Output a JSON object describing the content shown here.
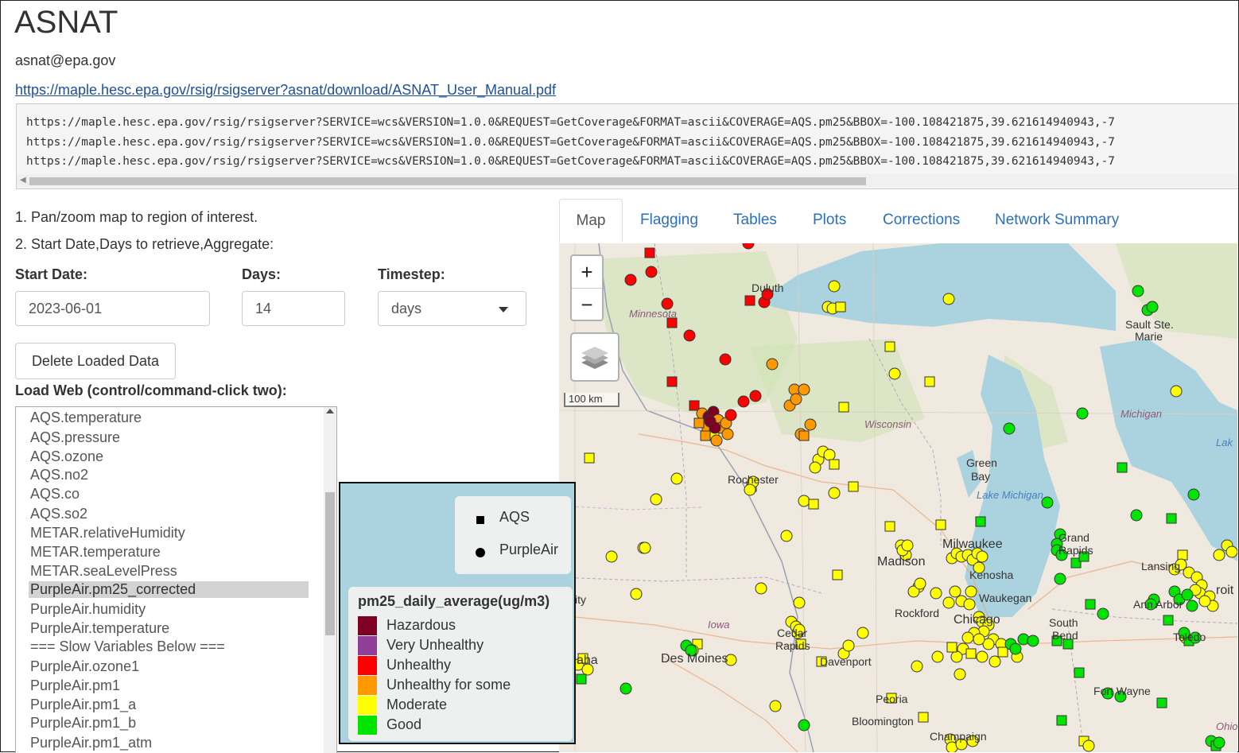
{
  "header": {
    "title": "ASNAT",
    "email": "asnat@epa.gov",
    "manual_link": "https://maple.hesc.epa.gov/rsig/rsigserver?asnat/download/ASNAT_User_Manual.pdf"
  },
  "request_urls": [
    "https://maple.hesc.epa.gov/rsig/rsigserver?SERVICE=wcs&VERSION=1.0.0&REQUEST=GetCoverage&FORMAT=ascii&COVERAGE=AQS.pm25&BBOX=-100.108421875,39.621614940943,-7",
    "https://maple.hesc.epa.gov/rsig/rsigserver?SERVICE=wcs&VERSION=1.0.0&REQUEST=GetCoverage&FORMAT=ascii&COVERAGE=AQS.pm25&BBOX=-100.108421875,39.621614940943,-7",
    "https://maple.hesc.epa.gov/rsig/rsigserver?SERVICE=wcs&VERSION=1.0.0&REQUEST=GetCoverage&FORMAT=ascii&COVERAGE=AQS.pm25&BBOX=-100.108421875,39.621614940943,-7"
  ],
  "steps": {
    "step1": "1. Pan/zoom map to region of interest.",
    "step2": "2. Start Date,Days to retrieve,Aggregate:"
  },
  "form": {
    "start_date_label": "Start Date:",
    "start_date_value": "2023-06-01",
    "days_label": "Days:",
    "days_value": "14",
    "timestep_label": "Timestep:",
    "timestep_value": "days",
    "delete_button": "Delete Loaded Data",
    "load_web_label": "Load Web (control/command-click two):"
  },
  "variables": [
    "AQS.temperature",
    "AQS.pressure",
    "AQS.ozone",
    "AQS.no2",
    "AQS.co",
    "AQS.so2",
    "METAR.relativeHumidity",
    "METAR.temperature",
    "METAR.seaLevelPress",
    "PurpleAir.pm25_corrected",
    "PurpleAir.humidity",
    "PurpleAir.temperature",
    "=== Slow Variables Below ===",
    "PurpleAir.ozone1",
    "PurpleAir.pm1",
    "PurpleAir.pm1_a",
    "PurpleAir.pm1_b",
    "PurpleAir.pm1_atm"
  ],
  "selected_variable": "PurpleAir.pm25_corrected",
  "tabs": [
    "Map",
    "Flagging",
    "Tables",
    "Plots",
    "Corrections",
    "Network Summary"
  ],
  "active_tab": "Map",
  "map": {
    "zoom_in": "+",
    "zoom_out": "−",
    "scale_label": "100 km",
    "labels": {
      "duluth": "Duluth",
      "minnesota": "Minnesota",
      "sault_ste_marie_1": "Sault Ste.",
      "sault_ste_marie_2": "Marie",
      "michigan": "Michigan",
      "wisconsin": "Wisconsin",
      "lake_partial": "Lak",
      "green_bay_1": "Green",
      "green_bay_2": "Bay",
      "rochester": "Rochester",
      "lake_michigan": "Lake Michigan",
      "grand_rapids_1": "Grand",
      "grand_rapids_2": "Rapids",
      "milwaukee": "Milwaukee",
      "madison": "Madison",
      "kenosha": "Kenosha",
      "lansing": "Lansing",
      "detroit_partial": "roit",
      "waukegan": "Waukegan",
      "rockford": "Rockford",
      "ann_arbor": "Ann Arbor",
      "chicago": "Chicago",
      "iowa": "Iowa",
      "cedar_rapids_1": "Cedar",
      "cedar_rapids_2": "Rapids",
      "south_bend_1": "South",
      "south_bend_2": "Bend",
      "toledo": "Toledo",
      "des_moines": "Des Moines",
      "davenport": "Davenport",
      "omaha_partial": "aha",
      "sioux_partial": "ity",
      "fort_wayne": "Fort Wayne",
      "peoria": "Peoria",
      "bloomington": "Bloomington",
      "champaign": "Champaign",
      "ohio_partial": "Ohio"
    }
  },
  "legend": {
    "symbols": [
      {
        "label": "AQS",
        "shape": "square"
      },
      {
        "label": "PurpleAir",
        "shape": "circle"
      }
    ],
    "title": "pm25_daily_average(ug/m3)",
    "categories": [
      {
        "label": "Hazardous",
        "color": "#7e0023"
      },
      {
        "label": "Very Unhealthy",
        "color": "#8f3f97"
      },
      {
        "label": "Unhealthy",
        "color": "#ff0000"
      },
      {
        "label": "Unhealthy for some",
        "color": "#ff9900"
      },
      {
        "label": "Moderate",
        "color": "#ffff00"
      },
      {
        "label": "Good",
        "color": "#00e400"
      }
    ]
  }
}
